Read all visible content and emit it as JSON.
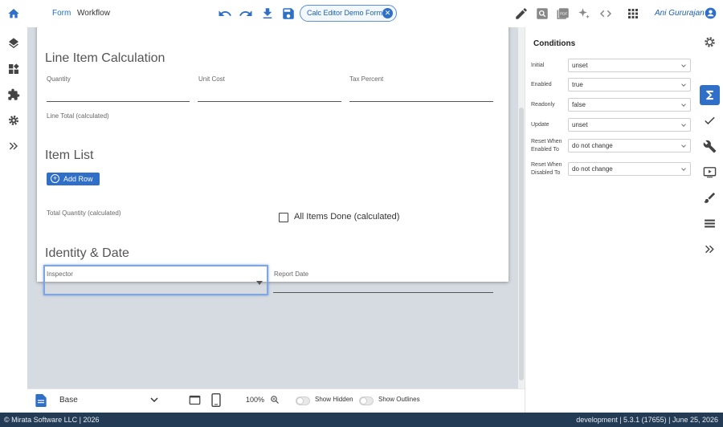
{
  "topbar": {
    "tabs": [
      "Form",
      "Workflow"
    ],
    "active_tab": "Form",
    "form_chip": "Calc Editor Demo Form",
    "user": "Ani Gururajan",
    "icons": [
      "home-icon",
      "undo-icon",
      "redo-icon",
      "download-icon",
      "save-icon",
      "edit-icon",
      "preview-icon",
      "pdf-icon",
      "sparkle-icon",
      "code-icon",
      "apps-grid-icon",
      "account-icon"
    ]
  },
  "left_sidebar": {
    "icons": [
      "layers-icon",
      "widgets-icon",
      "extension-icon",
      "settings-icon",
      "expand-icon"
    ]
  },
  "form": {
    "sections": [
      {
        "title": "Line Item Calculation",
        "fields": [
          "Quantity",
          "Unit Cost",
          "Tax Percent",
          "Line Total (calculated)"
        ]
      },
      {
        "title": "Item List",
        "add_row_label": "Add Row",
        "fields": [
          "Total Quantity (calculated)"
        ],
        "checkbox_label": "All Items Done (calculated)"
      },
      {
        "title": "Identity & Date",
        "fields": [
          "Inspector",
          "Report Date"
        ]
      }
    ]
  },
  "conditions_panel": {
    "title": "Conditions",
    "properties": [
      {
        "label": "Initial",
        "value": "unset"
      },
      {
        "label": "Enabled",
        "value": "true"
      },
      {
        "label": "Readonly",
        "value": "false"
      },
      {
        "label": "Update",
        "value": "unset"
      },
      {
        "label": "Reset When Enabled To",
        "value": "do not change"
      },
      {
        "label": "Reset When Disabled To",
        "value": "do not change"
      }
    ]
  },
  "right_sidebar": {
    "icons": [
      "settings-icon",
      "sigma-icon",
      "check-icon",
      "wrench-icon",
      "video-icon",
      "brush-icon",
      "list-icon",
      "expand-icon"
    ],
    "active_icon": "sigma-icon"
  },
  "bottom_bar": {
    "page_select": "Base",
    "zoom": "100%",
    "show_hidden": "Show Hidden",
    "show_outlines": "Show Outlines"
  },
  "footer": {
    "left": "© Mirata Software LLC | 2026",
    "right": "development | 5.3.1 (17655) | June 25, 2026"
  },
  "colors": {
    "accent": "#2f6fc8",
    "footer_bg": "#243b55",
    "canvas_bg": "#d6dbe1"
  }
}
